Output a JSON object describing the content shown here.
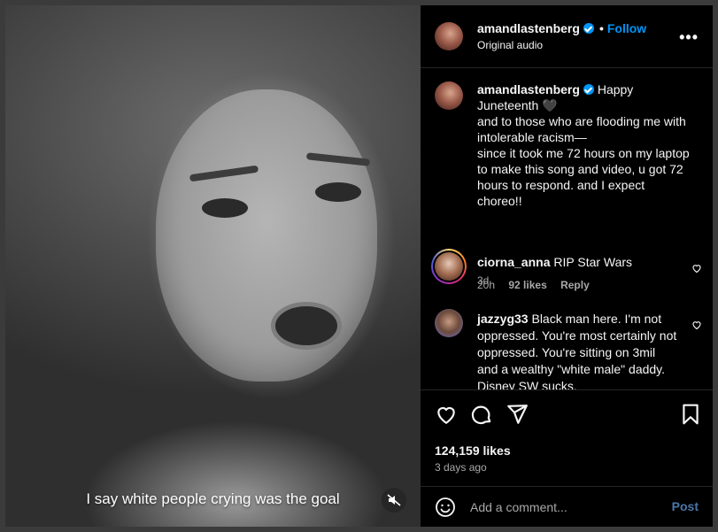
{
  "video": {
    "caption": "I say white people crying was the goal",
    "mute_icon": "speaker-muted-icon"
  },
  "header": {
    "username": "amandlastenberg",
    "separator": "•",
    "follow_label": "Follow",
    "subtitle": "Original audio",
    "more_icon": "•••"
  },
  "post_caption": {
    "username": "amandlastenberg",
    "text_line1": "Happy Juneteenth 🖤",
    "text_rest": "and to those who are flooding me with intolerable racism—\nsince it took me 72 hours on my laptop to make this song and video, u got 72 hours to respond. and I expect choreo!!",
    "time": "3d"
  },
  "comments": [
    {
      "username": "ciorna_anna",
      "text": "RIP Star Wars",
      "time": "20h",
      "likes": "92 likes",
      "reply": "Reply"
    },
    {
      "username": "jazzyg33",
      "text": "Black man here. I'm not oppressed. You're most certainly not oppressed. You're sitting on 3mil and a wealthy \"white male\" daddy. Disney SW sucks."
    }
  ],
  "actions": {
    "likes": "124,159 likes",
    "ago": "3 days ago"
  },
  "add_comment": {
    "placeholder": "Add a comment...",
    "post_label": "Post"
  },
  "colors": {
    "accent": "#0095f6",
    "post_disabled": "#4a77a8",
    "muted_text": "#a8a8a8",
    "border": "#262626"
  }
}
